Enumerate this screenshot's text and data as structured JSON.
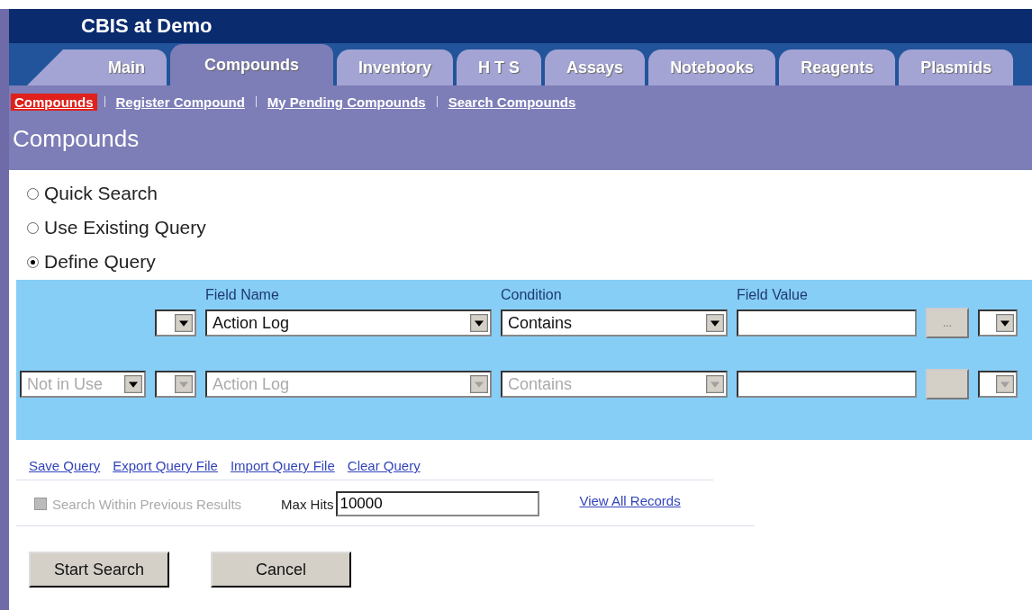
{
  "header": {
    "title": "CBIS at Demo"
  },
  "tabs": [
    {
      "label": "Main",
      "selected": false
    },
    {
      "label": "Compounds",
      "selected": true
    },
    {
      "label": "Inventory",
      "selected": false
    },
    {
      "label": "H T S",
      "selected": false
    },
    {
      "label": "Assays",
      "selected": false
    },
    {
      "label": "Notebooks",
      "selected": false
    },
    {
      "label": "Reagents",
      "selected": false
    },
    {
      "label": "Plasmids",
      "selected": false
    }
  ],
  "subnav": [
    {
      "label": "Compounds",
      "selected": true
    },
    {
      "label": "Register Compound",
      "selected": false
    },
    {
      "label": "My Pending Compounds",
      "selected": false
    },
    {
      "label": "Search Compounds",
      "selected": false
    }
  ],
  "page_title": "Compounds",
  "search_modes": [
    {
      "label": "Quick Search",
      "selected": false
    },
    {
      "label": "Use Existing Query",
      "selected": false
    },
    {
      "label": "Define Query",
      "selected": true
    }
  ],
  "query": {
    "columns": [
      "Field Name",
      "Condition",
      "Field Value"
    ],
    "rows": [
      {
        "use": null,
        "field_name": "Action Log",
        "condition": "Contains",
        "browse": "...",
        "disabled": false
      },
      {
        "use": "Not in Use",
        "field_name": "Action Log",
        "condition": "Contains",
        "browse": "",
        "disabled": true
      }
    ]
  },
  "query_links": [
    "Save Query",
    "Export Query File",
    "Import Query File",
    "Clear Query"
  ],
  "search_within": {
    "label": "Search Within Previous Results",
    "checked": false,
    "disabled": true
  },
  "max_hits": {
    "label": "Max Hits",
    "value": "10000"
  },
  "view_all": "View All Records",
  "buttons": [
    "Start Search",
    "Cancel"
  ]
}
